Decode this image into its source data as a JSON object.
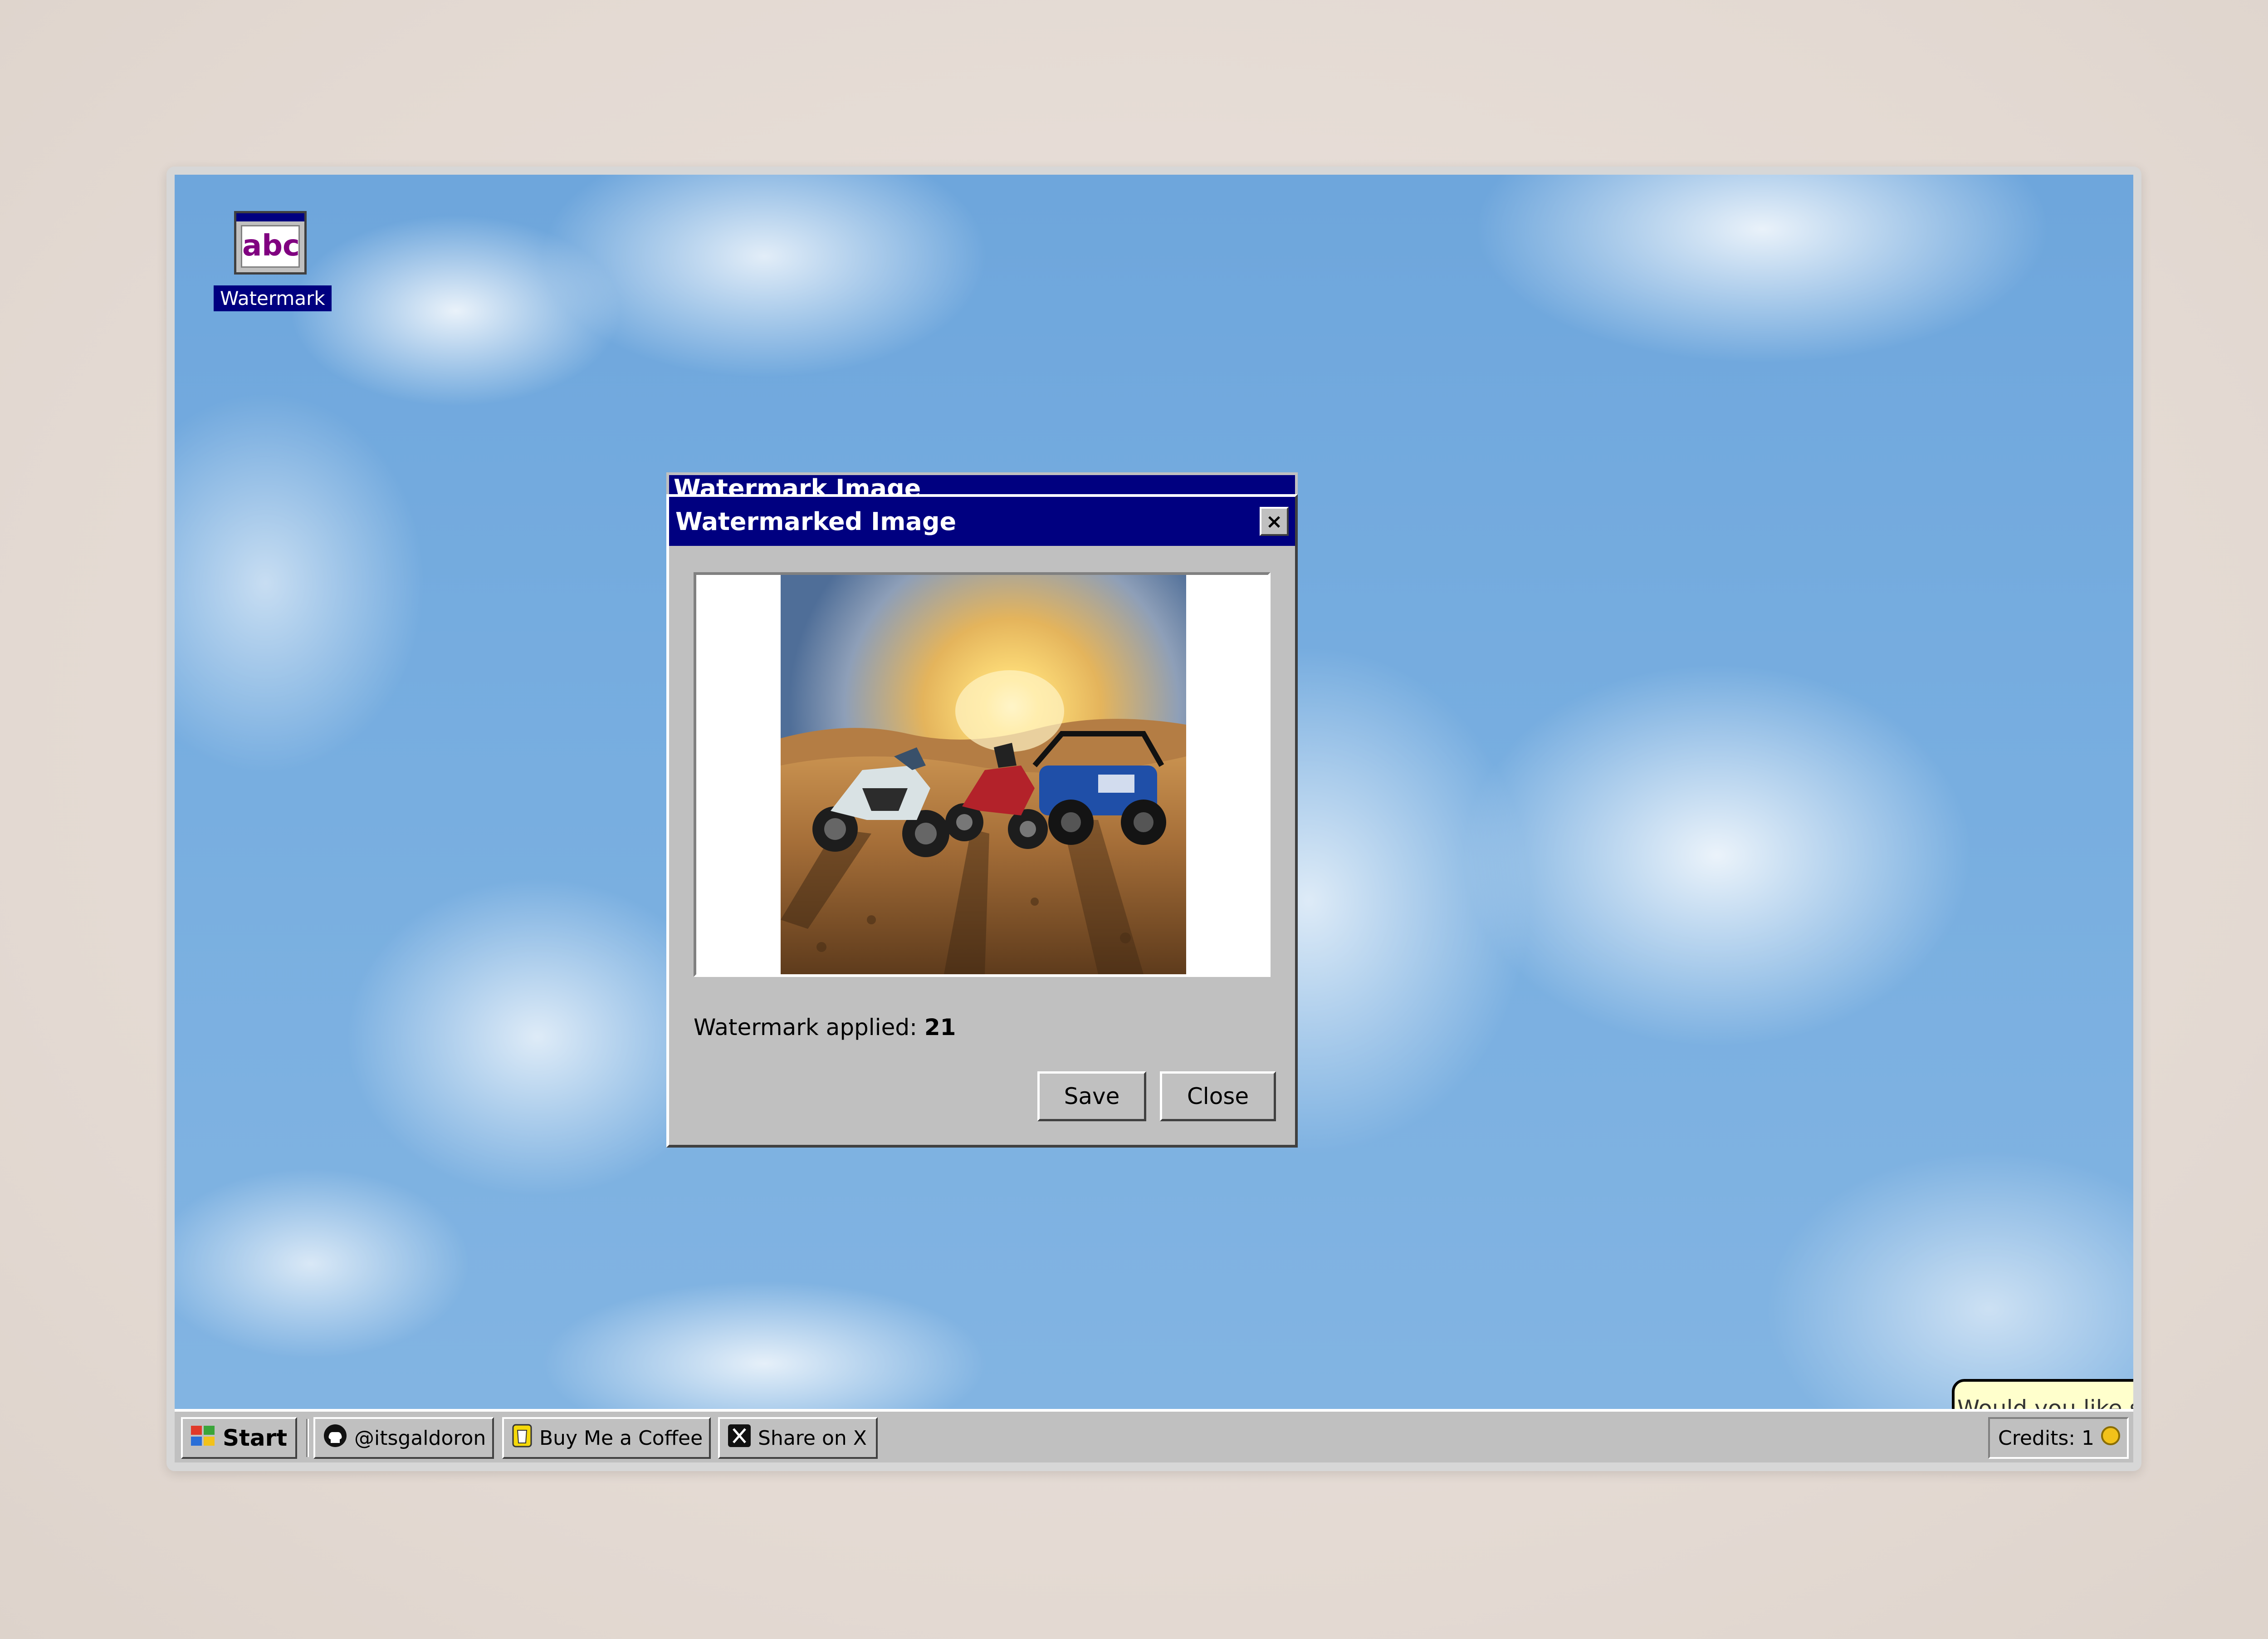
{
  "desktop": {
    "icons": [
      {
        "label": "Watermark",
        "glyph_text": "abc",
        "icon": "watermark-app-icon"
      }
    ]
  },
  "back_window": {
    "title": "Watermark Image"
  },
  "dialog": {
    "title": "Watermarked Image",
    "close_glyph": "×",
    "status_label": "Watermark applied:",
    "status_value": "21",
    "save_label": "Save",
    "close_label": "Close"
  },
  "assistant": {
    "bubble_text": "Would you like some help?",
    "icon": "paperclip-assistant-icon"
  },
  "taskbar": {
    "start_label": "Start",
    "items": [
      {
        "label": "@itsgaldoron",
        "icon": "github-icon"
      },
      {
        "label": "Buy Me a Coffee",
        "icon": "coffee-cup-icon"
      },
      {
        "label": "Share on X",
        "icon": "x-logo-icon"
      }
    ],
    "credits_label": "Credits: 1",
    "credits_icon": "coin-icon"
  },
  "colors": {
    "titlebar": "#000080",
    "chrome": "#c0c0c0",
    "bubble": "#ffffcc",
    "sky": "#78aee0"
  }
}
